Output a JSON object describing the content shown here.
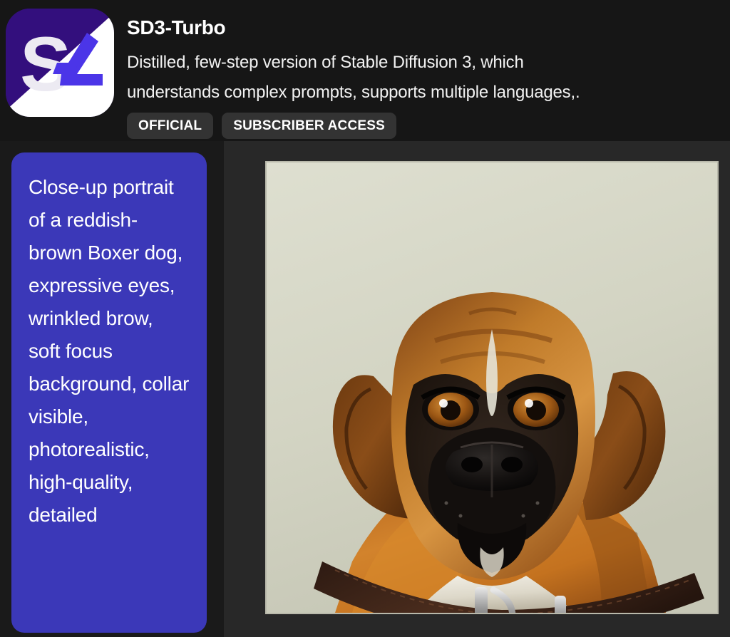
{
  "model": {
    "name": "SD3-Turbo",
    "description": "Distilled, few-step version of Stable Diffusion 3, which\nunderstands complex prompts, supports multiple languages,.",
    "logo_icon": "sd-logo-icon",
    "logo_letter_s": "S",
    "badges": [
      {
        "label": "OFFICIAL",
        "name": "badge-official"
      },
      {
        "label": "SUBSCRIBER ACCESS",
        "name": "badge-subscriber-access"
      }
    ]
  },
  "prompt": {
    "text": "Close-up portrait of a reddish-brown Boxer dog, expressive eyes, wrinkled brow, soft focus background, collar visible, photorealistic, high-quality, detailed"
  },
  "generated_image": {
    "alt": "Close-up photorealistic portrait of a reddish-brown Boxer dog with dark muzzle, amber eyes and a brown leather collar on a pale sage background",
    "name": "generated-dog-portrait"
  },
  "colors": {
    "accent": "#3b38b8",
    "header_bg": "#161616",
    "panel_bg": "#282828",
    "prompt_col_bg": "#1a1a1a",
    "badge_bg": "#333333",
    "logo_purple": "#330f7d",
    "image_bg": "#d7d8c8"
  }
}
